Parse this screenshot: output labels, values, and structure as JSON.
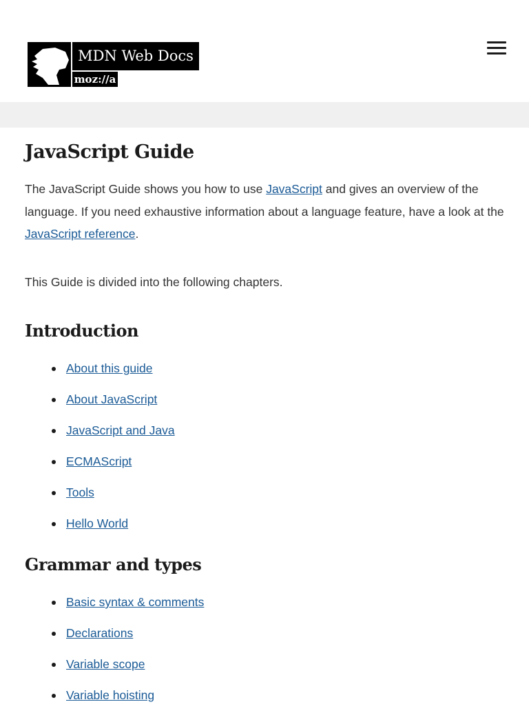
{
  "header": {
    "logo_title": "MDN Web Docs",
    "logo_sub": "moz://a",
    "menu_icon": "hamburger-menu-icon"
  },
  "main": {
    "title": "JavaScript Guide",
    "intro": {
      "t1": "The JavaScript Guide shows you how to use ",
      "link1": "JavaScript",
      "t2": " and gives an overview of the language. If you need exhaustive information about a language feature, have a look at the ",
      "link2": "JavaScript reference",
      "t3": "."
    },
    "chapters_text": "This Guide is divided into the following chapters.",
    "sections": [
      {
        "heading": "Introduction",
        "items": [
          "About this guide",
          "About JavaScript",
          "JavaScript and Java",
          "ECMAScript",
          "Tools",
          "Hello World"
        ]
      },
      {
        "heading": "Grammar and types",
        "items": [
          "Basic syntax & comments",
          "Declarations",
          "Variable scope",
          "Variable hoisting"
        ]
      }
    ]
  }
}
